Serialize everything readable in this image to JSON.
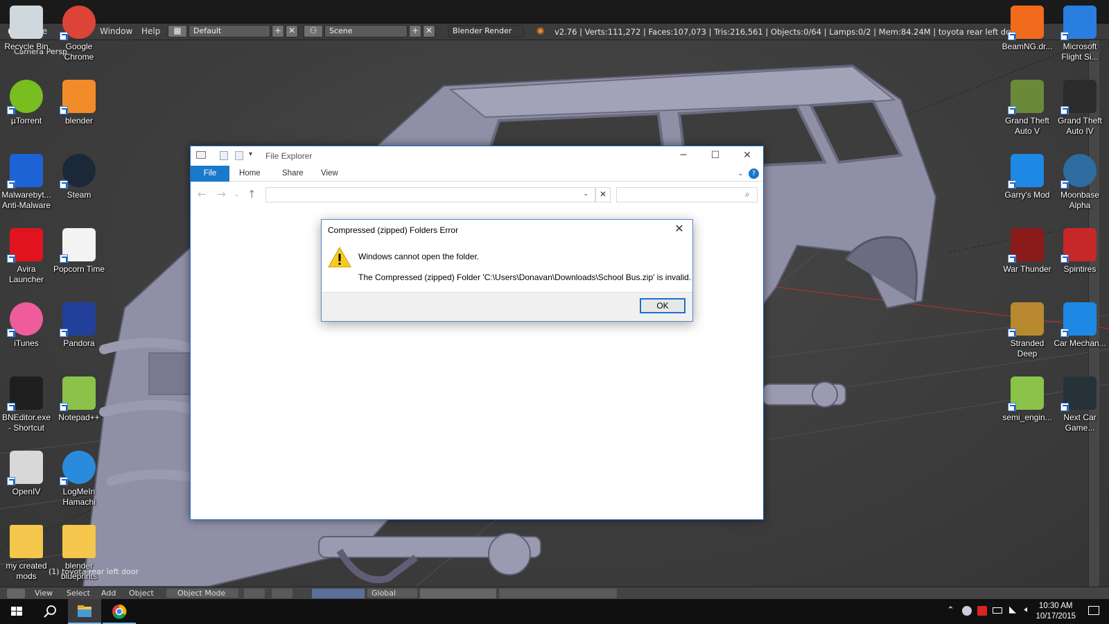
{
  "blender": {
    "menus": [
      "File",
      "Window",
      "Help"
    ],
    "layout_name": "Default",
    "scene_name": "Scene",
    "render_engine": "Blender Render",
    "stats": "v2.76 | Verts:111,272 | Faces:107,073 | Tris:216,561 | Objects:0/64 | Lamps:0/2 | Mem:84.24M | toyota rear left door",
    "viewport_label_top": "Camera Persp",
    "viewport_label_bottom": "(1) toyota rear left door",
    "bottom_bar": {
      "view": "View",
      "select": "Select",
      "add": "Add",
      "object": "Object",
      "mode": "Object Mode",
      "orientation": "Global"
    }
  },
  "desktop_left": [
    {
      "label": "Recycle Bin",
      "icon": "recycle-bin-icon"
    },
    {
      "label": "Google Chrome",
      "icon": "chrome-icon"
    },
    {
      "label": "µTorrent",
      "icon": "utorrent-icon"
    },
    {
      "label": "blender",
      "icon": "blender-icon"
    },
    {
      "label": "Malwarebyt... Anti-Malware",
      "icon": "malwarebytes-icon"
    },
    {
      "label": "Steam",
      "icon": "steam-icon"
    },
    {
      "label": "Avira Launcher",
      "icon": "avira-icon"
    },
    {
      "label": "Popcorn Time",
      "icon": "popcorn-icon"
    },
    {
      "label": "iTunes",
      "icon": "itunes-icon"
    },
    {
      "label": "Pandora",
      "icon": "pandora-icon"
    },
    {
      "label": "BNEditor.exe - Shortcut",
      "icon": "bneditor-icon"
    },
    {
      "label": "Notepad++",
      "icon": "notepadpp-icon"
    },
    {
      "label": "OpenIV",
      "icon": "openiv-icon"
    },
    {
      "label": "LogMeIn Hamachi",
      "icon": "hamachi-icon"
    },
    {
      "label": "my created mods",
      "icon": "folder-icon"
    },
    {
      "label": "blender blueprints",
      "icon": "folder-icon"
    }
  ],
  "desktop_right": [
    {
      "label": "BeamNG.dr...",
      "icon": "beamng-icon"
    },
    {
      "label": "Microsoft Flight Si...",
      "icon": "flight-sim-icon"
    },
    {
      "label": "Grand Theft Auto V",
      "icon": "gta5-icon"
    },
    {
      "label": "Grand Theft Auto IV",
      "icon": "gta4-icon"
    },
    {
      "label": "Garry's Mod",
      "icon": "garrysmod-icon"
    },
    {
      "label": "Moonbase Alpha",
      "icon": "moonbase-icon"
    },
    {
      "label": "War Thunder",
      "icon": "warthunder-icon"
    },
    {
      "label": "Spintires",
      "icon": "spintires-icon"
    },
    {
      "label": "Stranded Deep",
      "icon": "stranded-deep-icon"
    },
    {
      "label": "Car Mechan...",
      "icon": "car-mechanic-icon"
    },
    {
      "label": "semi_engin...",
      "icon": "semi-engine-icon"
    },
    {
      "label": "Next Car Game...",
      "icon": "next-car-game-icon"
    }
  ],
  "explorer": {
    "title": "File Explorer",
    "tabs": [
      "File",
      "Home",
      "Share",
      "View"
    ],
    "address_value": "",
    "search_value": ""
  },
  "dialog": {
    "title": "Compressed (zipped) Folders Error",
    "message": "Windows cannot open the folder.",
    "detail": "The Compressed (zipped) Folder 'C:\\Users\\Donavan\\Downloads\\School Bus.zip' is invalid.",
    "ok_label": "OK"
  },
  "taskbar": {
    "time": "10:30 AM",
    "date": "10/17/2015"
  },
  "colors": {
    "accent": "#1979ca",
    "blender_bg": "#3d3d3d",
    "taskbar": "#101010"
  }
}
